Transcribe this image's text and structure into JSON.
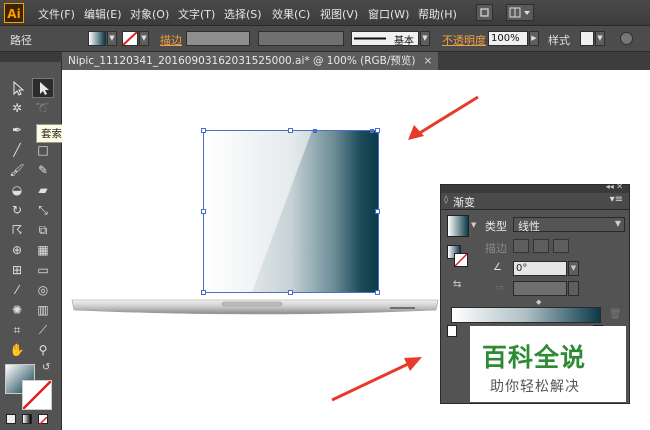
{
  "app": {
    "logo": "Ai"
  },
  "menu": {
    "items": [
      "文件(F)",
      "编辑(E)",
      "对象(O)",
      "文字(T)",
      "选择(S)",
      "效果(C)",
      "视图(V)",
      "窗口(W)",
      "帮助(H)"
    ]
  },
  "control_bar": {
    "object_label": "路径",
    "stroke_label": "描边",
    "brush_label": "基本",
    "opacity_label": "不透明度",
    "opacity_value": "100%",
    "style_label": "样式"
  },
  "document": {
    "tab_title": "Nipic_11120341_20160903162031525000.ai* @ 100% (RGB/预览)",
    "close_glyph": "×"
  },
  "tooltip": "套索工具 (Q)",
  "gradient_panel": {
    "title": "渐变",
    "type_label": "类型",
    "type_value": "线性",
    "stroke_label": "描边",
    "angle_value": "0°",
    "colors": {
      "start": "#ffffff",
      "end": "#0c3a48"
    }
  },
  "watermark": {
    "title": "百科全说",
    "subtitle": "助你轻松解决"
  },
  "colors": {
    "accent": "#ff9a00",
    "selection": "#4a6ccf",
    "arrow": "#e83a2a"
  }
}
